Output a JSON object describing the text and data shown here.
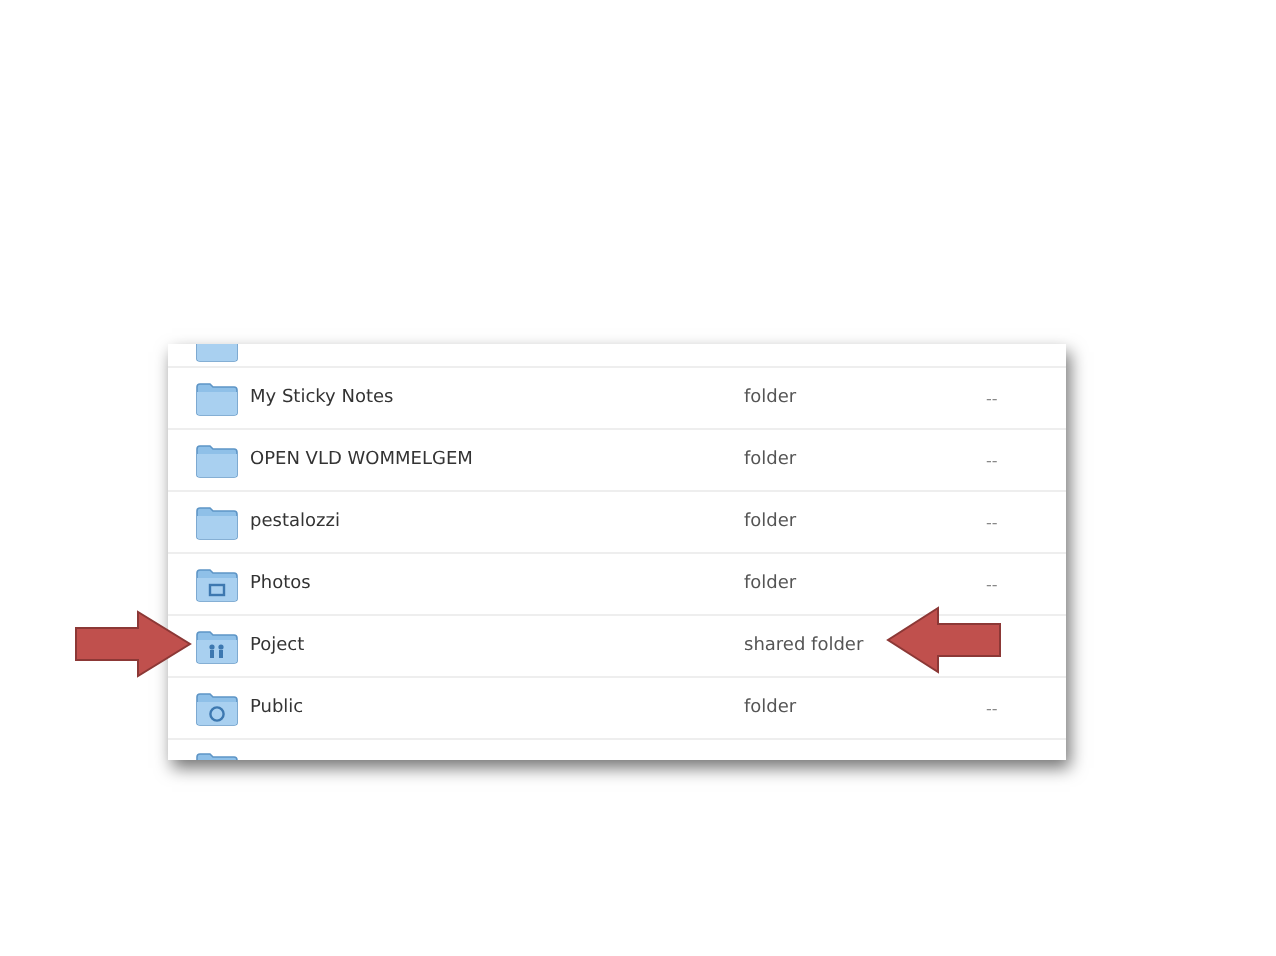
{
  "file_list": {
    "rows": [
      {
        "kind": "folder",
        "name": "My Sticky Notes",
        "type": "folder",
        "modified": "--"
      },
      {
        "kind": "folder",
        "name": "OPEN VLD WOMMELGEM",
        "type": "folder",
        "modified": "--"
      },
      {
        "kind": "folder",
        "name": "pestalozzi",
        "type": "folder",
        "modified": "--"
      },
      {
        "kind": "photos",
        "name": "Photos",
        "type": "folder",
        "modified": "--"
      },
      {
        "kind": "shared",
        "name": "Poject",
        "type": "shared folder"
      },
      {
        "kind": "public",
        "name": "Public",
        "type": "folder",
        "modified": "--"
      }
    ]
  },
  "arrows": [
    {
      "kind": "right"
    },
    {
      "kind": "left"
    }
  ]
}
